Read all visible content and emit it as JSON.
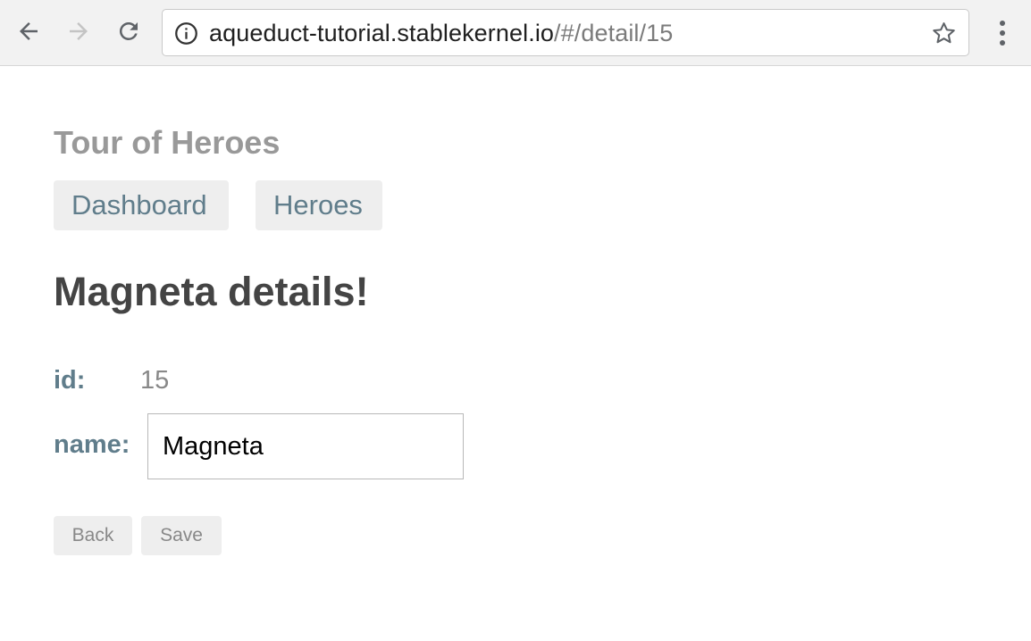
{
  "browser": {
    "url_host": "aqueduct-tutorial.stablekernel.io",
    "url_path": "/#/detail/15",
    "icons": {
      "back": "arrow-left-icon",
      "forward": "arrow-right-icon",
      "reload": "reload-icon",
      "info": "info-icon",
      "bookmark": "star-icon",
      "menu": "vertical-dots-menu-icon"
    }
  },
  "app": {
    "title": "Tour of Heroes",
    "nav": [
      {
        "label": "Dashboard"
      },
      {
        "label": "Heroes"
      }
    ]
  },
  "detail": {
    "heading": "Magneta details!",
    "id_label": "id:",
    "id_value": "15",
    "name_label": "name:",
    "name_value": "Magneta",
    "back_label": "Back",
    "save_label": "Save"
  },
  "colors": {
    "accent": "#607d8b",
    "title_gray": "#999999",
    "button_bg": "#eeeeee"
  }
}
